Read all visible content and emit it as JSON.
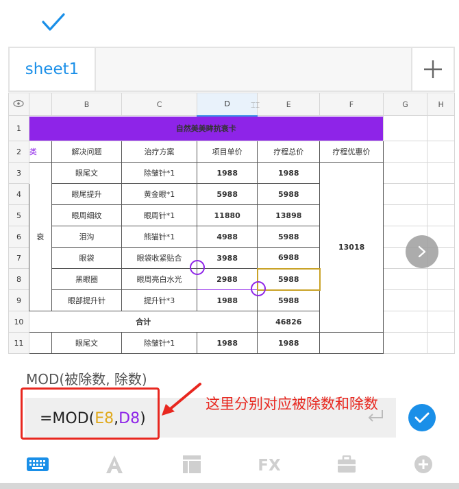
{
  "sheet_tab": {
    "label": "sheet1"
  },
  "columns": [
    "",
    "B",
    "C",
    "D",
    "E",
    "F",
    "G",
    "H"
  ],
  "title_row": {
    "row": "1",
    "text": "自然美美眸抗衰卡"
  },
  "header_row": {
    "row": "2",
    "left_fragment": "类",
    "cells": [
      "解决问题",
      "治疗方案",
      "项目单价",
      "疗程总价",
      "疗程优惠价"
    ]
  },
  "rows": [
    {
      "row": "3",
      "b": "眼尾文",
      "c": "除皱针*1",
      "d": "1988",
      "e": "1988"
    },
    {
      "row": "4",
      "b": "眼尾提升",
      "c": "黄金眼*1",
      "d": "5988",
      "e": "5988"
    },
    {
      "row": "5",
      "b": "眼周细纹",
      "c": "眼周针*1",
      "d": "11880",
      "e": "13898"
    },
    {
      "row": "6",
      "b": "泪沟",
      "c": "熊猫针*1",
      "d": "4988",
      "e": "5988"
    },
    {
      "row": "7",
      "b": "眼袋",
      "c": "眼袋收紧贴合",
      "d": "3988",
      "e": "6988"
    },
    {
      "row": "8",
      "b": "黑眼圈",
      "c": "眼周亮白水光",
      "d": "2988",
      "e": "5988"
    },
    {
      "row": "9",
      "b": "眼部提升针",
      "c": "提升针*3",
      "d": "1988",
      "e": "5988"
    }
  ],
  "merged_f_value": "13018",
  "left_side_fragment": "衰",
  "total_row": {
    "row": "10",
    "label": "合计",
    "value": "46826"
  },
  "row11": {
    "row": "11",
    "b": "眼尾文",
    "c": "除皱针*1",
    "d": "1988",
    "e": "1988"
  },
  "formula": {
    "hint": "MOD(被除数, 除数)",
    "prefix": "=MOD(",
    "arg1": "E8",
    "sep": ",",
    "arg2": "D8",
    "suffix": ")"
  },
  "annotation": "这里分别对应被除数和除数",
  "toolbar_icons": [
    "keyboard-icon",
    "text-format-icon",
    "cell-format-icon",
    "function-icon",
    "toolbox-icon",
    "insert-icon"
  ],
  "colors": {
    "accent_blue": "#1a8fe8",
    "purple": "#8e24e8",
    "annotation_red": "#e8271f",
    "ref_gold": "#e0a91c"
  }
}
